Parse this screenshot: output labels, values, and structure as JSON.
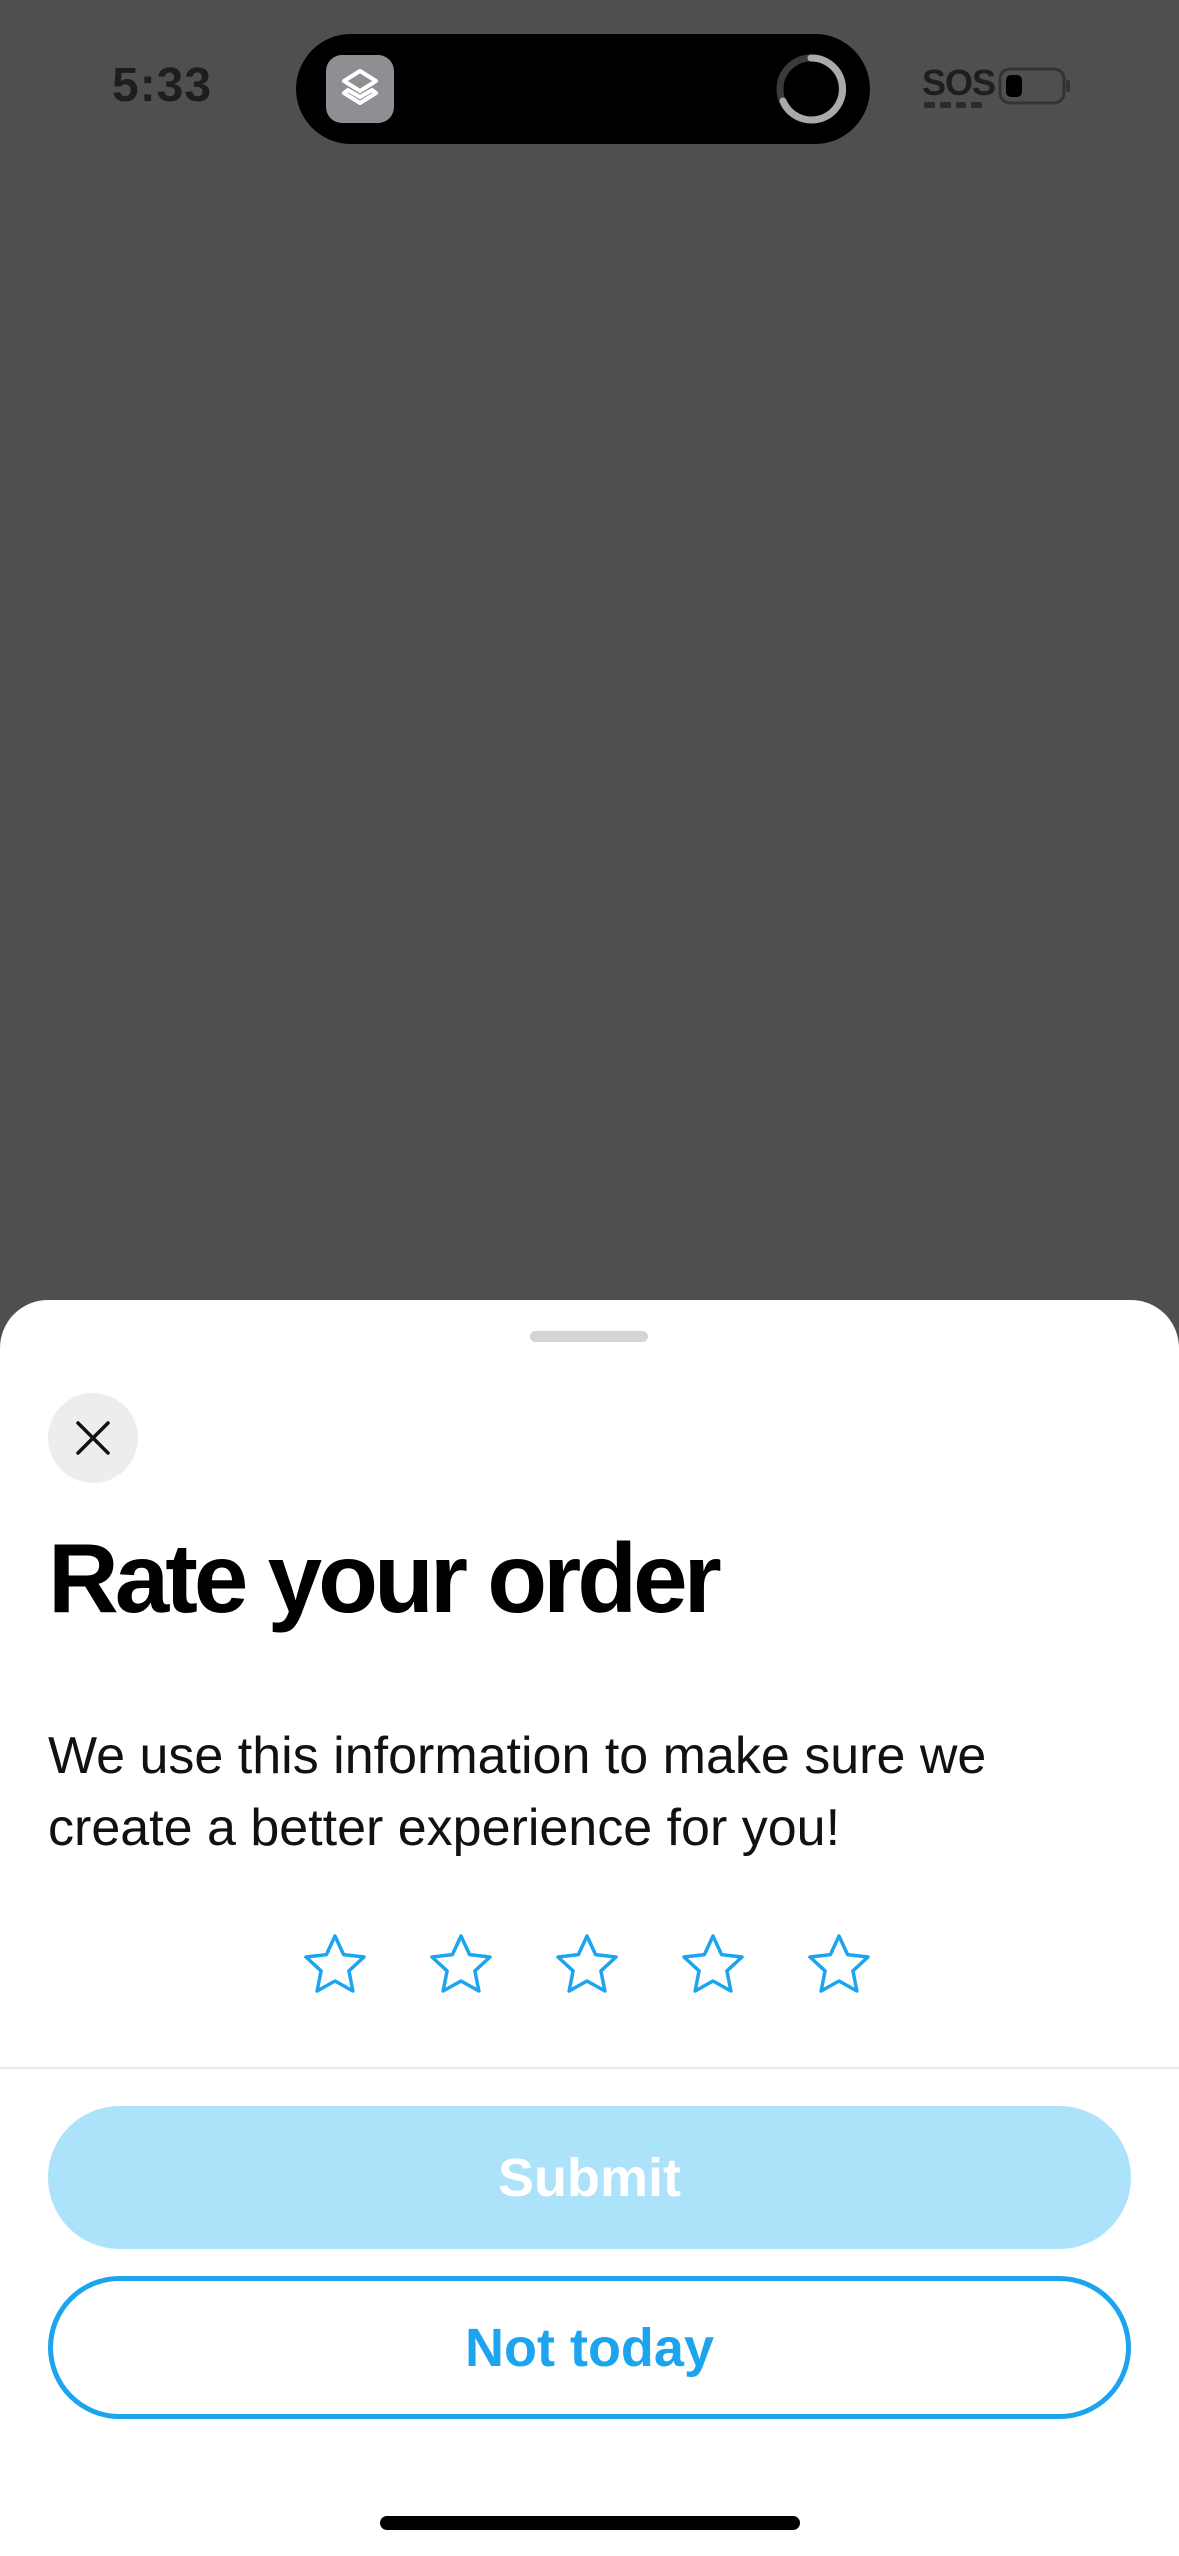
{
  "status_bar": {
    "time": "5:33",
    "carrier_status": "SOS",
    "island_icon": "layers-app-icon",
    "activity_icon": "progress-ring-icon",
    "battery_icon": "battery-low-icon"
  },
  "sheet": {
    "close_icon": "close-icon",
    "title": "Rate your order",
    "description": "We use this information to make sure we create a better experience for you!",
    "rating": {
      "max": 5,
      "selected": 0,
      "star_icon": "star-outline-icon"
    },
    "submit_label": "Submit",
    "dismiss_label": "Not today"
  },
  "colors": {
    "accent": "#1CA4EF",
    "submit_disabled": "#ADE2FB",
    "overlay": "#4F4F4F",
    "close_bg": "#EDEDEB"
  }
}
